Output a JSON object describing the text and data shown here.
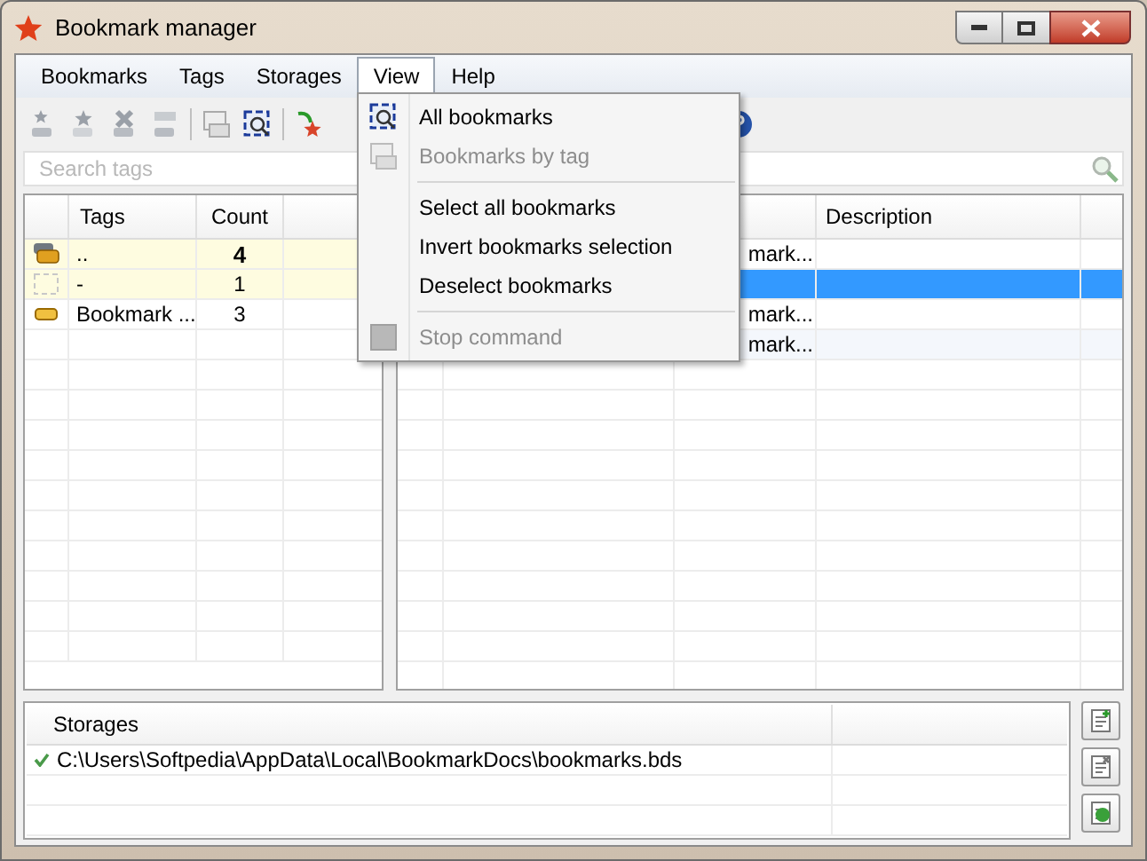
{
  "window": {
    "title": "Bookmark manager"
  },
  "menu_bar": [
    {
      "label": "Bookmarks",
      "selected": false
    },
    {
      "label": "Tags",
      "selected": false
    },
    {
      "label": "Storages",
      "selected": false
    },
    {
      "label": "View",
      "selected": true
    },
    {
      "label": "Help",
      "selected": false
    }
  ],
  "view_menu": [
    {
      "kind": "item",
      "label": "All bookmarks",
      "disabled": false
    },
    {
      "kind": "item",
      "label": "Bookmarks by tag",
      "disabled": true
    },
    {
      "kind": "separator"
    },
    {
      "kind": "item",
      "label": "Select all bookmarks",
      "disabled": false
    },
    {
      "kind": "item",
      "label": "Invert bookmarks selection",
      "disabled": false
    },
    {
      "kind": "item",
      "label": "Deselect bookmarks",
      "disabled": false
    },
    {
      "kind": "separator"
    },
    {
      "kind": "item",
      "label": "Stop command",
      "disabled": true
    }
  ],
  "tag_search": {
    "placeholder": "Search tags"
  },
  "tags_table": {
    "columns": [
      "Tags",
      "Count"
    ],
    "rows": [
      {
        "tag": "..",
        "count": "4",
        "highlighted": true,
        "bold": true
      },
      {
        "tag": "-",
        "count": "1",
        "highlighted": true,
        "bold": false
      },
      {
        "tag": "Bookmark ...",
        "count": "3",
        "highlighted": false,
        "bold": false
      }
    ]
  },
  "bookmarks_table": {
    "columns": [
      "Description"
    ],
    "rows": [
      {
        "column_3": "mark...",
        "selected": false
      },
      {
        "selected": true
      },
      {
        "column_3": "mark...",
        "selected": false
      },
      {
        "column_3": "mark...",
        "selected": false
      }
    ]
  },
  "storages": {
    "columns": [
      "Storages"
    ],
    "rows": [
      {
        "path": "C:\\Users\\Softpedia\\AppData\\Local\\BookmarkDocs\\bookmarks.bds",
        "active": true
      }
    ]
  }
}
